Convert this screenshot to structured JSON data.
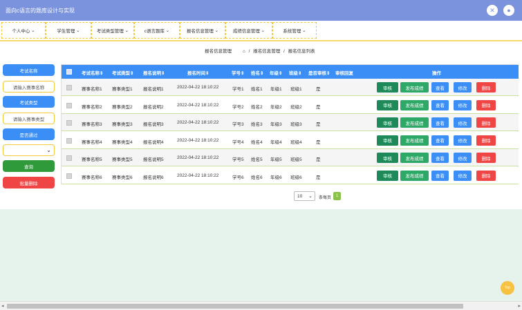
{
  "app": {
    "title": "面向c语言的题库设计与实现"
  },
  "topbar": {
    "icon_left": "close-circle-icon",
    "icon_right": "user-avatar-icon"
  },
  "nav": {
    "items": [
      {
        "label": "个人中心"
      },
      {
        "label": "学生管理"
      },
      {
        "label": "考试类型管理"
      },
      {
        "label": "c语言题库"
      },
      {
        "label": "报名信息管理"
      },
      {
        "label": "成绩信息管理"
      },
      {
        "label": "系统管理"
      }
    ]
  },
  "breadcrumb": {
    "title": "报名信息管理",
    "home_icon": "home-icon",
    "level1": "报名信息管理",
    "sep": "/",
    "level2": "报名信息列表"
  },
  "search": {
    "name_label": "考试名称",
    "name_placeholder": "请输入赛事名称",
    "type_label": "考试类型",
    "type_placeholder": "请输入赛事类型",
    "pass_label": "是否通过",
    "pass_value": "",
    "query_button": "查询",
    "batch_delete_button": "批量删除"
  },
  "table": {
    "headers": [
      "考试名称⇕",
      "考试类型⇕",
      "报名说明⇕",
      "报名时间⇕",
      "学号⇕",
      "姓名⇕",
      "年级⇕",
      "班级⇕",
      "是否审核⇕",
      "审核回复",
      "操作"
    ],
    "actions": [
      "审核",
      "发布成绩",
      "查看",
      "修改",
      "删除"
    ],
    "rows": [
      {
        "name": "赛事名称1",
        "type": "赛事类型1",
        "desc": "报名说明1",
        "time": "2022-04-22 18:10:22",
        "sid": "学号1",
        "sname": "姓名1",
        "grade": "年级1",
        "cls": "班级1",
        "reviewed": "是",
        "reply": ""
      },
      {
        "name": "赛事名称2",
        "type": "赛事类型2",
        "desc": "报名说明2",
        "time": "2022-04-22 18:10:22",
        "sid": "学号2",
        "sname": "姓名2",
        "grade": "年级2",
        "cls": "班级2",
        "reviewed": "是",
        "reply": ""
      },
      {
        "name": "赛事名称3",
        "type": "赛事类型3",
        "desc": "报名说明3",
        "time": "2022-04-22 18:10:22",
        "sid": "学号3",
        "sname": "姓名3",
        "grade": "年级3",
        "cls": "班级3",
        "reviewed": "是",
        "reply": ""
      },
      {
        "name": "赛事名称4",
        "type": "赛事类型4",
        "desc": "报名说明4",
        "time": "2022-04-22 18:10:22",
        "sid": "学号4",
        "sname": "姓名4",
        "grade": "年级4",
        "cls": "班级4",
        "reviewed": "是",
        "reply": ""
      },
      {
        "name": "赛事名称5",
        "type": "赛事类型5",
        "desc": "报名说明5",
        "time": "2022-04-22 18:10:22",
        "sid": "学号5",
        "sname": "姓名5",
        "grade": "年级5",
        "cls": "班级5",
        "reviewed": "是",
        "reply": ""
      },
      {
        "name": "赛事名称6",
        "type": "赛事类型6",
        "desc": "报名说明6",
        "time": "2022-04-22 18:10:22",
        "sid": "学号6",
        "sname": "姓名6",
        "grade": "年级6",
        "cls": "班级6",
        "reviewed": "是",
        "reply": ""
      }
    ]
  },
  "pagination": {
    "page_size": "10",
    "page_size_label": "条每页",
    "current_page": "1"
  },
  "float": {
    "top_label": "Top"
  },
  "colors": {
    "topbar": "#7b93dc",
    "header": "#3a8ef6",
    "review": "#1e8a5a",
    "publish": "#2ea866",
    "view": "#3a8ef6",
    "edit": "#3a8ef6",
    "delete": "#f04545",
    "query": "#2e9a3a",
    "batch_delete": "#f04545"
  }
}
